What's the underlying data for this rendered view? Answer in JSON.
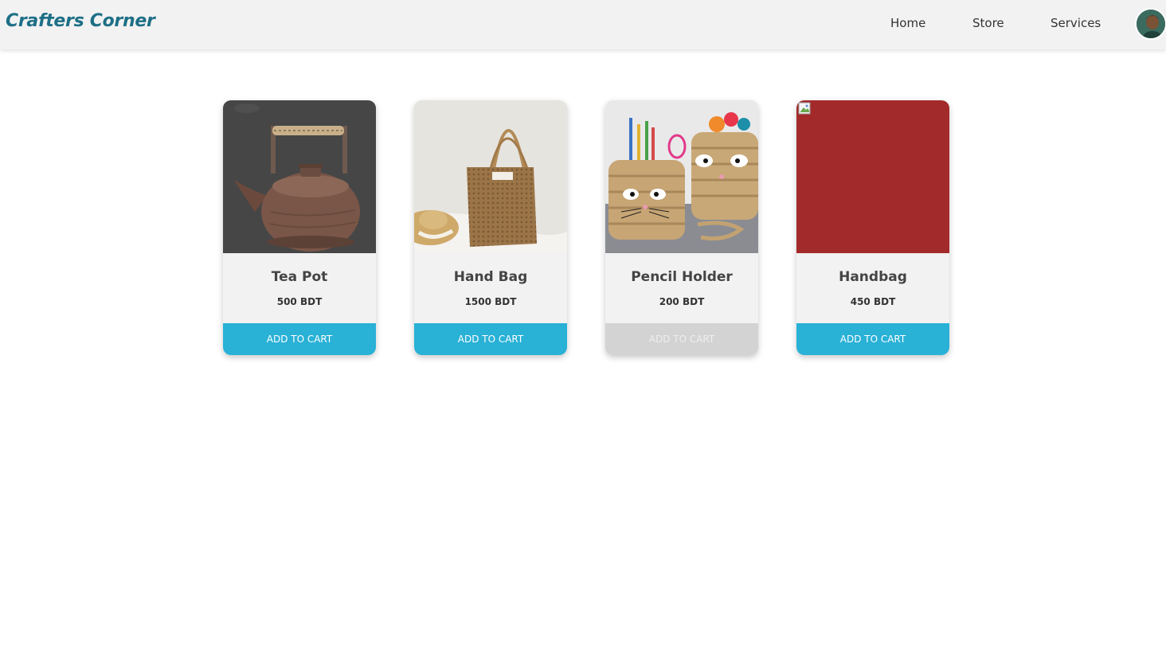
{
  "header": {
    "brand": "Crafters Corner",
    "nav": [
      "Home",
      "Store",
      "Services"
    ]
  },
  "products": [
    {
      "title": "Tea Pot",
      "price": "500 BDT",
      "button": "ADD TO CART",
      "button_state": "enabled"
    },
    {
      "title": "Hand Bag",
      "price": "1500 BDT",
      "button": "ADD TO CART",
      "button_state": "enabled"
    },
    {
      "title": "Pencil Holder",
      "price": "200 BDT",
      "button": "ADD TO CART",
      "button_state": "disabled"
    },
    {
      "title": "Handbag",
      "price": "450 BDT",
      "button": "ADD TO CART",
      "button_state": "enabled"
    }
  ],
  "colors": {
    "brand": "#1d6f86",
    "button": "#29b1d6",
    "button_disabled": "#d3d3d3",
    "card_bg": "#f2f2f2",
    "broken_image_bg": "#a32a2a"
  }
}
